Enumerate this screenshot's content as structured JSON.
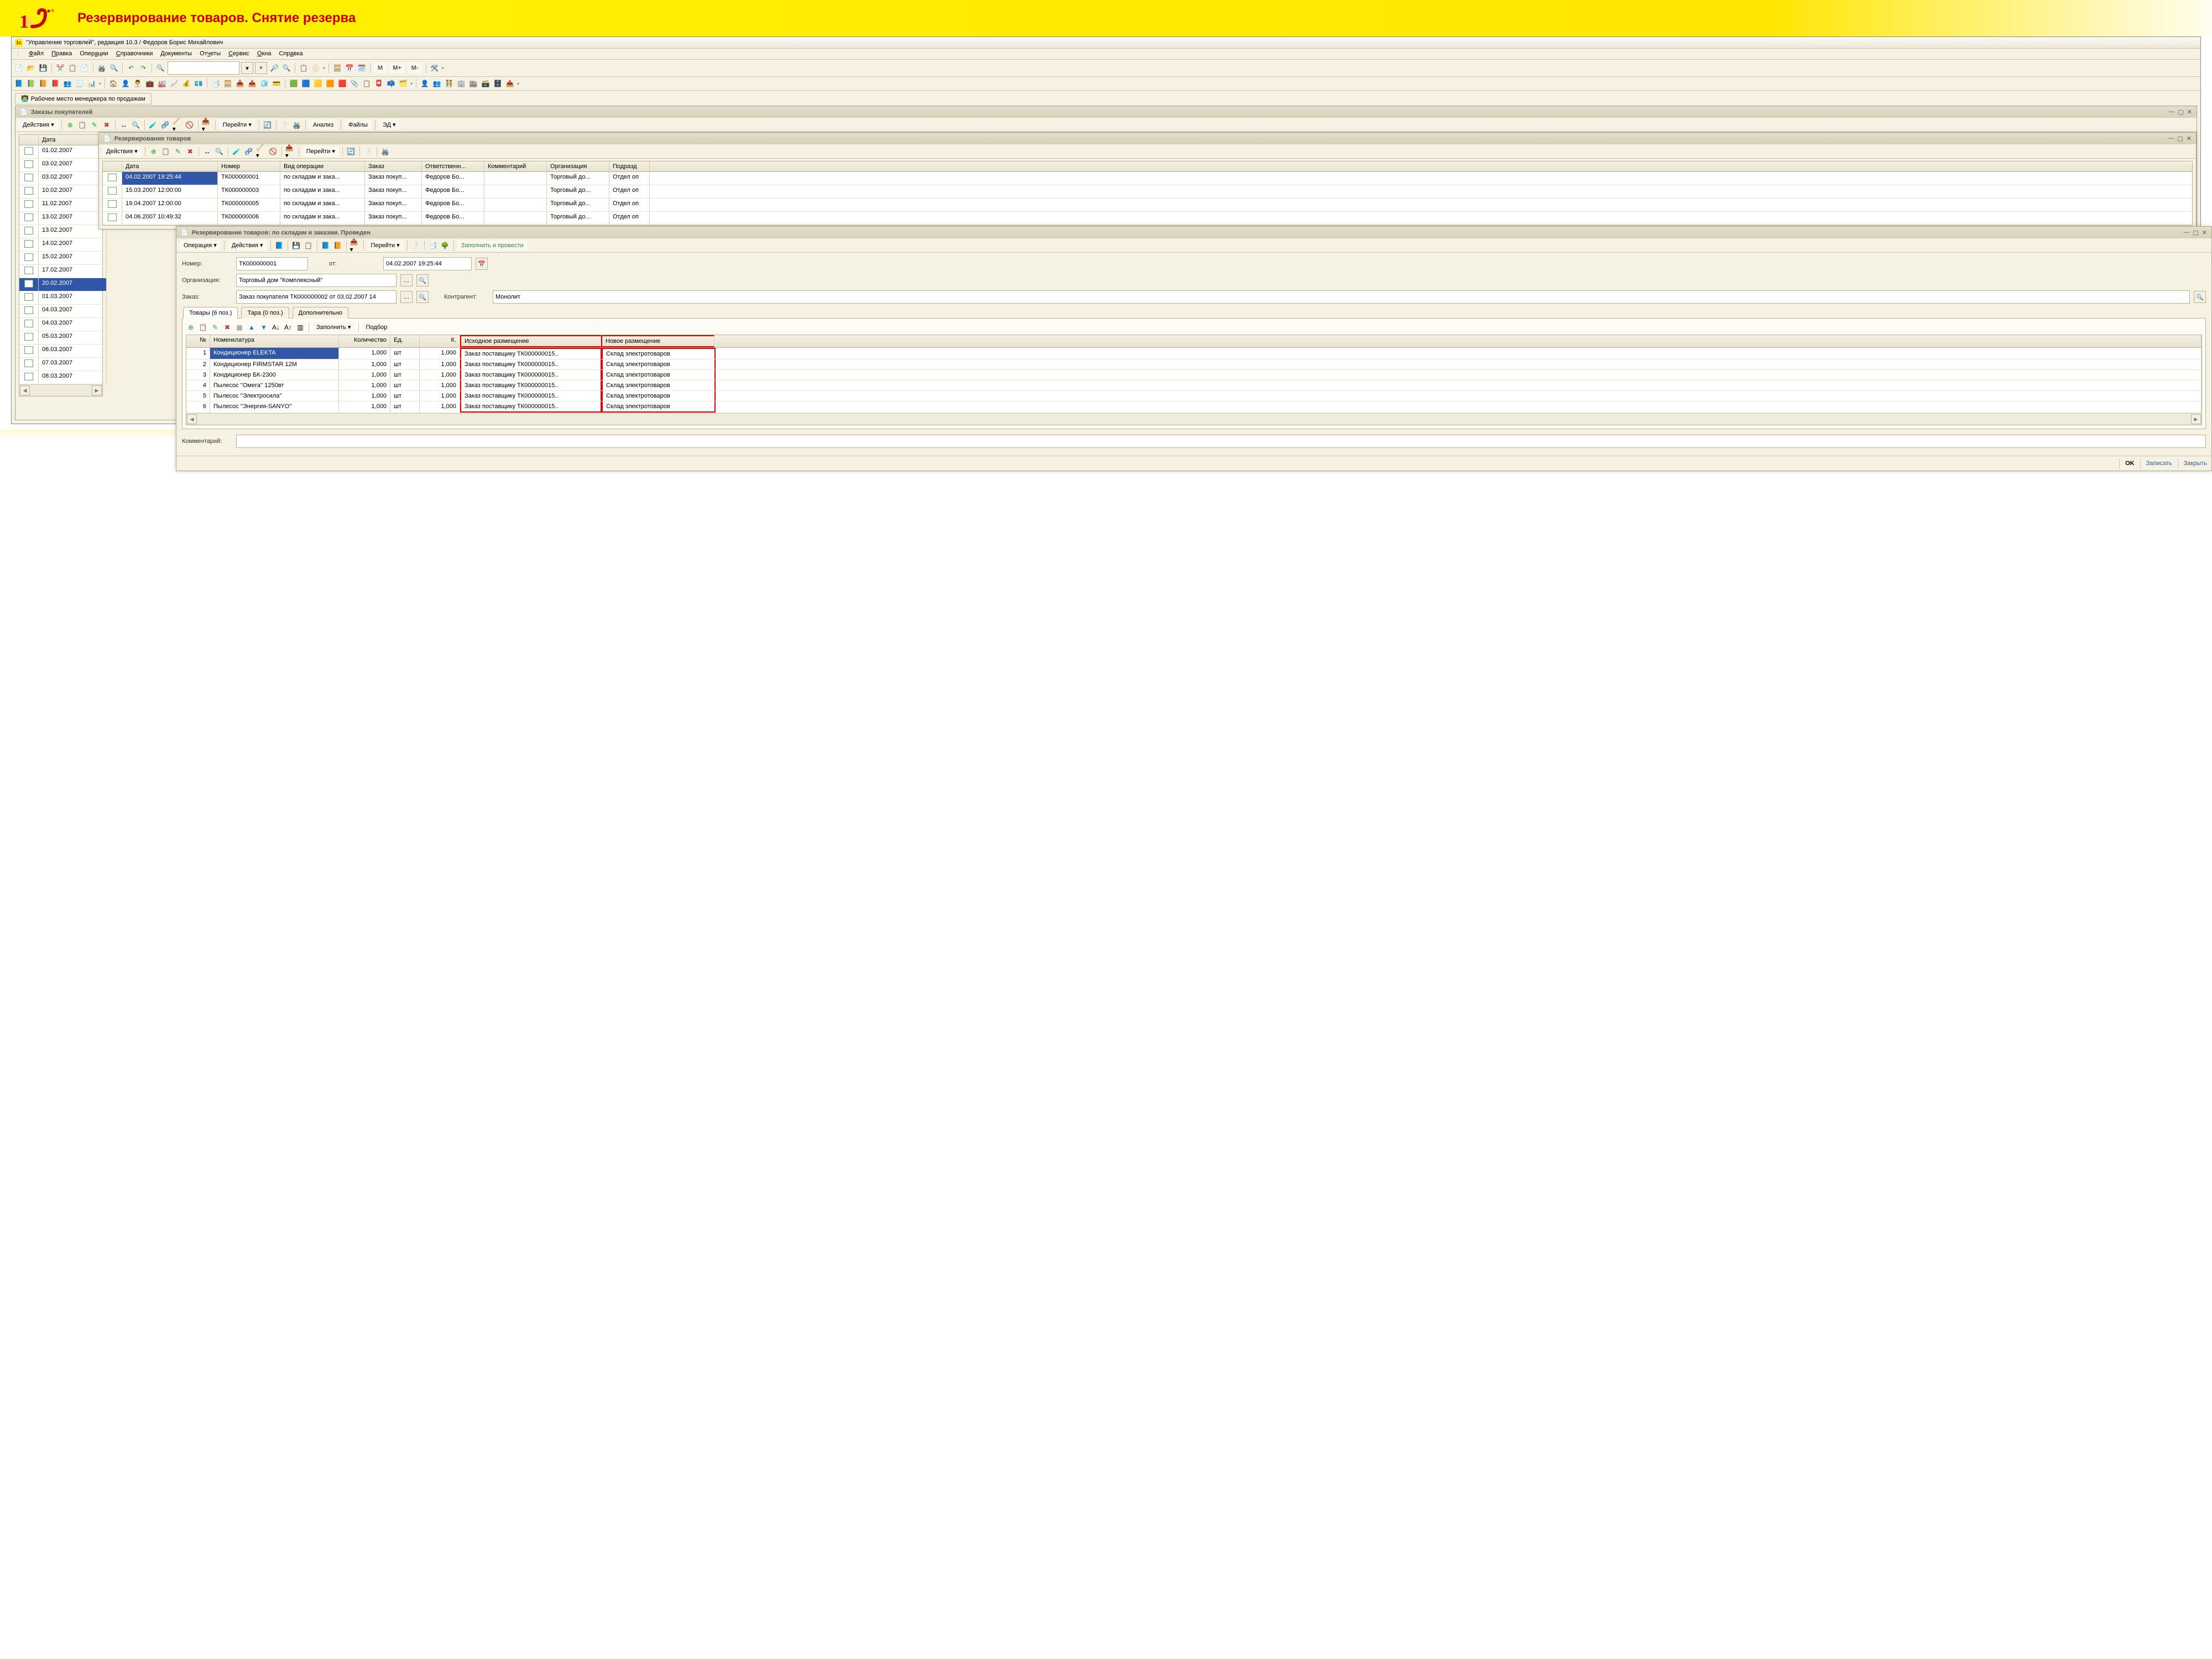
{
  "slide": {
    "title": "Резервирование товаров. Снятие резерва"
  },
  "app": {
    "title": "\"Управление торговлей\", редакция 10.3 / Федоров Борис Михайлович"
  },
  "menu": [
    "Файл",
    "Правка",
    "Операции",
    "Справочники",
    "Документы",
    "Отчеты",
    "Сервис",
    "Окна",
    "Справка"
  ],
  "main_toolbar": {
    "m_labels": [
      "M",
      "M+",
      "M-"
    ]
  },
  "workplace_tab": "Рабочее место менеджера по продажам",
  "orders_window": {
    "title": "Заказы покупателей",
    "actions_label": "Действия",
    "nav_label": "Перейти",
    "btn_analysis": "Анализ",
    "btn_files": "Файлы",
    "btn_ed": "ЭД",
    "col_date": "Дата",
    "rows": [
      "01.02.2007",
      "03.02.2007",
      "03.02.2007",
      "10.02.2007",
      "11.02.2007",
      "13.02.2007",
      "13.02.2007",
      "14.02.2007",
      "15.02.2007",
      "17.02.2007",
      "20.02.2007",
      "01.03.2007",
      "04.03.2007",
      "04.03.2007",
      "05.03.2007",
      "06.03.2007",
      "07.03.2007",
      "08.03.2007"
    ],
    "selected_index": 10
  },
  "reserv_list": {
    "title": "Резервирование товаров",
    "actions_label": "Действия",
    "nav_label": "Перейти",
    "columns": [
      "Дата",
      "Номер",
      "Вид операции",
      "Заказ",
      "Ответственн...",
      "Комментарий",
      "Организация",
      "Подразд"
    ],
    "rows": [
      {
        "date": "04.02.2007 19:25:44",
        "num": "ТК000000001",
        "op": "по складам и зака...",
        "order": "Заказ покуп...",
        "resp": "Федоров Бо...",
        "comm": "",
        "org": "Торговый до...",
        "dep": "Отдел оп"
      },
      {
        "date": "15.03.2007 12:00:00",
        "num": "ТК000000003",
        "op": "по складам и зака...",
        "order": "Заказ покуп...",
        "resp": "Федоров Бо...",
        "comm": "",
        "org": "Торговый до...",
        "dep": "Отдел оп"
      },
      {
        "date": "19.04.2007 12:00:00",
        "num": "ТК000000005",
        "op": "по складам и зака...",
        "order": "Заказ покуп...",
        "resp": "Федоров Бо...",
        "comm": "",
        "org": "Торговый до...",
        "dep": "Отдел оп"
      },
      {
        "date": "04.06.2007 10:49:32",
        "num": "ТК000000006",
        "op": "по складам и зака...",
        "order": "Заказ покуп...",
        "resp": "Федоров Бо...",
        "comm": "",
        "org": "Торговый до...",
        "dep": "Отдел оп"
      }
    ]
  },
  "doc": {
    "title": "Резервирование товаров: по складам и заказам. Проведен",
    "btn_op": "Операция",
    "btn_actions": "Действия",
    "btn_nav": "Перейти",
    "btn_fillpost": "Заполнить и провести",
    "label_num": "Номер:",
    "num": "ТК000000001",
    "label_ot": "от:",
    "date": "04.02.2007 19:25:44",
    "label_org": "Организация:",
    "org": "Торговый дом ''Комплексный''",
    "label_order": "Заказ:",
    "order": "Заказ покупателя ТК000000002 от 03.02.2007 14",
    "label_ka": "Контрагент:",
    "ka": "Монолит",
    "tabs": [
      "Товары (6 поз.)",
      "Тара (0 поз.)",
      "Дополнительно"
    ],
    "fill_label": "Заполнить",
    "pick_label": "Подбор",
    "goods_columns": [
      "№",
      "Номенклатура",
      "Количество",
      "Ед.",
      "К.",
      "Исходное размещение",
      "Новое размещение"
    ],
    "goods": [
      {
        "n": 1,
        "nom": "Кондиционер ELEKTA",
        "qty": "1,000",
        "ed": "шт",
        "k": "1,000",
        "src": "Заказ поставщику ТК000000015..",
        "new": "Склад электротоваров"
      },
      {
        "n": 2,
        "nom": "Кондиционер FIRMSTAR 12M",
        "qty": "1,000",
        "ed": "шт",
        "k": "1,000",
        "src": "Заказ поставщику ТК000000015..",
        "new": "Склад электротоваров"
      },
      {
        "n": 3,
        "nom": "Кондиционер БК-2300",
        "qty": "1,000",
        "ed": "шт",
        "k": "1,000",
        "src": "Заказ поставщику ТК000000015..",
        "new": "Склад электротоваров"
      },
      {
        "n": 4,
        "nom": "Пылесос ''Омега'' 1250вт",
        "qty": "1,000",
        "ed": "шт",
        "k": "1,000",
        "src": "Заказ поставщику ТК000000015..",
        "new": "Склад электротоваров"
      },
      {
        "n": 5,
        "nom": "Пылесос ''Электросила''",
        "qty": "1,000",
        "ed": "шт",
        "k": "1,000",
        "src": "Заказ поставщику ТК000000015..",
        "new": "Склад электротоваров"
      },
      {
        "n": 6,
        "nom": "Пылесос ''Энергия-SANYO''",
        "qty": "1,000",
        "ed": "шт",
        "k": "1,000",
        "src": "Заказ поставщику ТК000000015..",
        "new": "Склад электротоваров"
      }
    ],
    "comment_label": "Комментарий:",
    "comment": "",
    "btn_ok": "OK",
    "btn_save": "Записать",
    "btn_close": "Закрыть"
  }
}
